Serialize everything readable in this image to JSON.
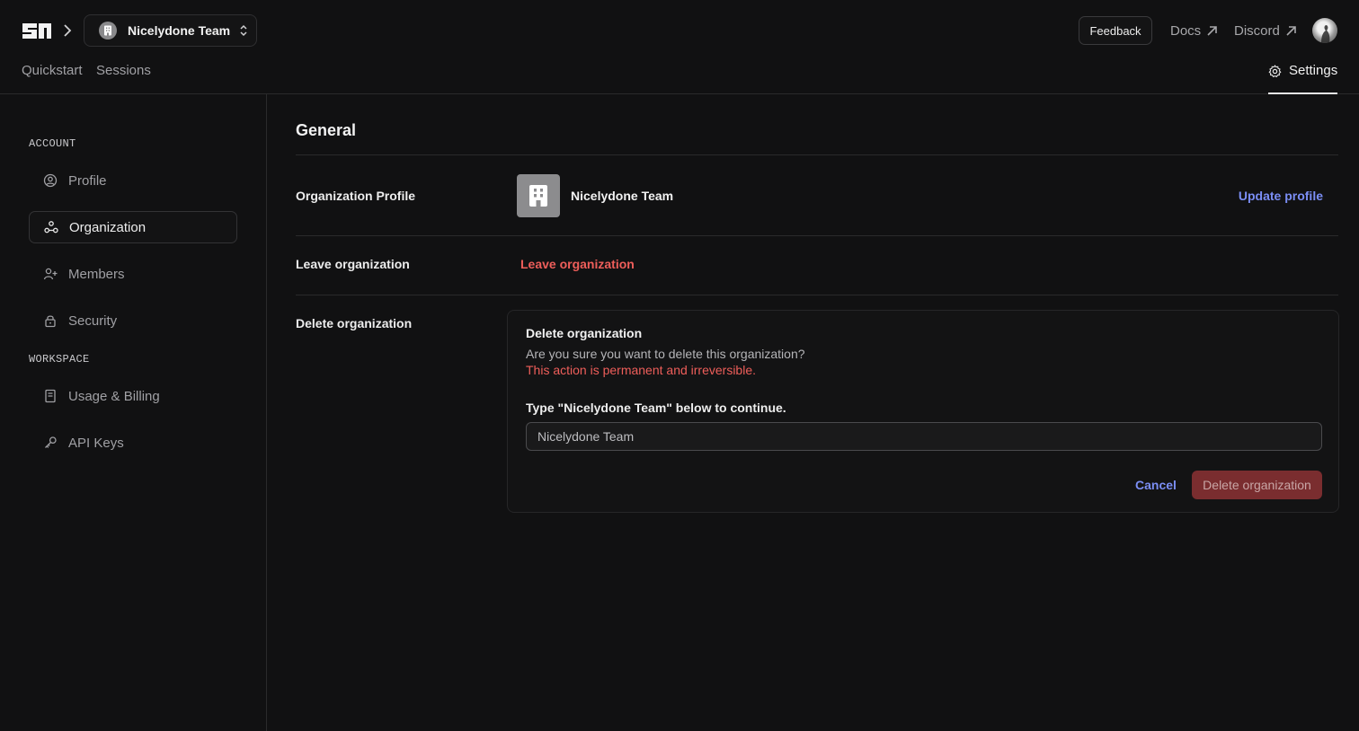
{
  "header": {
    "logo_icon": "sl-logo-icon",
    "team_name": "Nicelydone Team",
    "feedback_label": "Feedback",
    "docs_label": "Docs",
    "discord_label": "Discord",
    "tabs": [
      {
        "label": "Quickstart"
      },
      {
        "label": "Sessions"
      }
    ],
    "settings_label": "Settings"
  },
  "sidebar": {
    "account_heading": "ACCOUNT",
    "workspace_heading": "WORKSPACE",
    "items": [
      {
        "label": "Profile",
        "icon": "user-circle-icon"
      },
      {
        "label": "Organization",
        "icon": "organization-icon",
        "active": true
      },
      {
        "label": "Members",
        "icon": "user-plus-icon"
      },
      {
        "label": "Security",
        "icon": "lock-icon"
      },
      {
        "label": "Usage & Billing",
        "icon": "receipt-icon"
      },
      {
        "label": "API Keys",
        "icon": "key-icon"
      }
    ]
  },
  "main": {
    "title": "General",
    "org_profile_label": "Organization Profile",
    "org_name": "Nicelydone Team",
    "update_profile_label": "Update profile",
    "leave_label": "Leave organization",
    "leave_link": "Leave organization",
    "delete_label": "Delete organization",
    "card": {
      "title": "Delete organization",
      "question": "Are you sure you want to delete this organization?",
      "warning": "This action is permanent and irreversible.",
      "prompt": "Type \"Nicelydone Team\" below to continue.",
      "input_value": "Nicelydone Team",
      "cancel_label": "Cancel",
      "delete_label": "Delete organization"
    }
  },
  "colors": {
    "accent": "#7b8ef5",
    "danger": "#ee5e5a",
    "danger_button": "#7a2d2f",
    "background": "#111112"
  }
}
